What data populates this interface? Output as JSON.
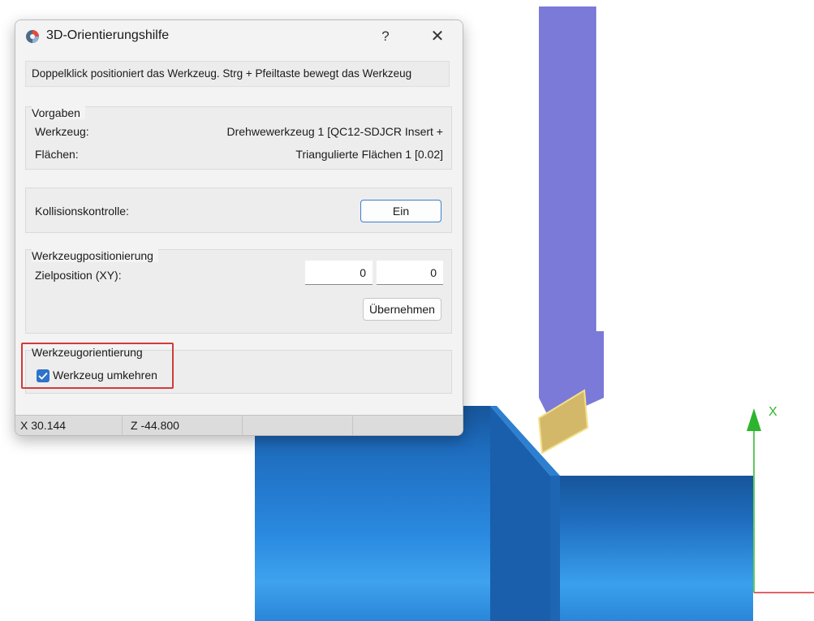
{
  "dialog": {
    "title": "3D-Orientierungshilfe",
    "help_label": "?",
    "close_label": "✕",
    "hint": "Doppelklick positioniert das Werkzeug. Strg + Pfeiltaste bewegt das Werkzeug",
    "vorgaben": {
      "label": "Vorgaben",
      "werkzeug_label": "Werkzeug:",
      "werkzeug_value": "Drehwewerkzeug 1 [QC12-SDJCR Insert +",
      "flaechen_label": "Flächen:",
      "flaechen_value": "Triangulierte Flächen 1 [0.02]"
    },
    "kollision": {
      "label": "Kollisionskontrolle:",
      "button": "Ein"
    },
    "positionierung": {
      "label": "Werkzeugpositionierung",
      "ziel_label": "Zielposition (XY):",
      "x_value": "0",
      "y_value": "0",
      "apply_button": "Übernehmen"
    },
    "orientierung": {
      "label": "Werkzeugorientierung",
      "checkbox_label": "Werkzeug umkehren",
      "checked": true
    },
    "status": {
      "x": "X  30.144",
      "z": "Z  -44.800"
    }
  },
  "viewport": {
    "axis_label": "X",
    "colors": {
      "holder": "#7b7ad8",
      "insert": "#e0c070",
      "workpiece": "#1e78d0",
      "axis_green": "#2cb52c",
      "axis_red": "#d83030"
    }
  }
}
